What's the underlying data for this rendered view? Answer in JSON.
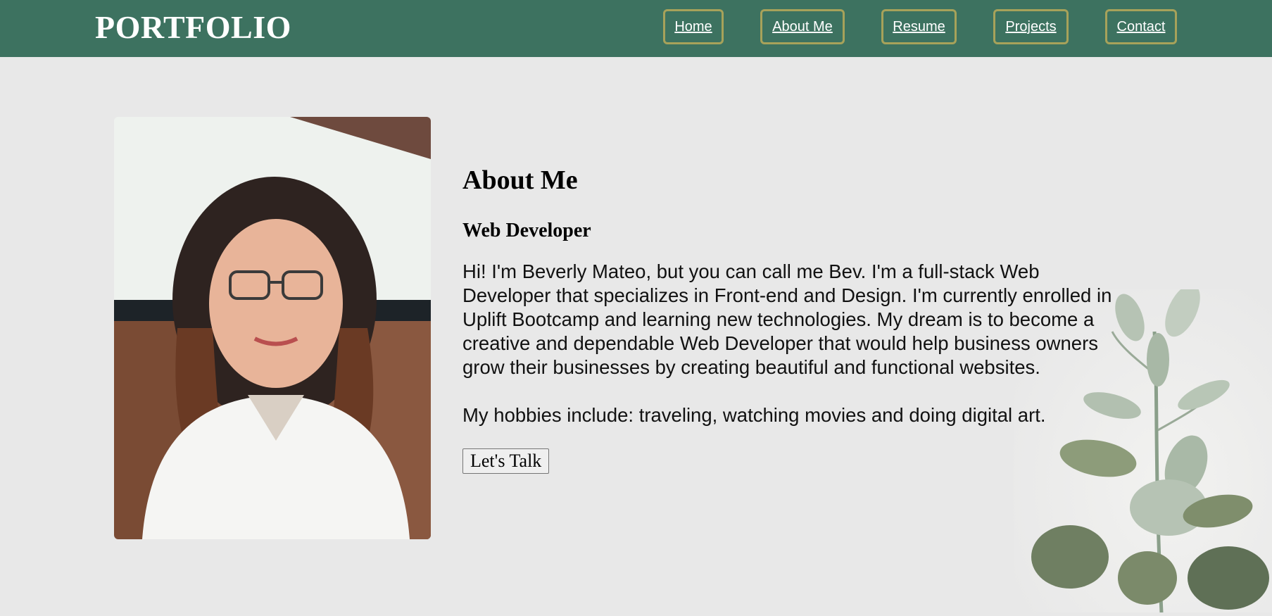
{
  "header": {
    "brand": "PORTFOLIO",
    "nav": [
      {
        "label": "Home"
      },
      {
        "label": "About Me"
      },
      {
        "label": "Resume"
      },
      {
        "label": "Projects"
      },
      {
        "label": "Contact"
      }
    ]
  },
  "about": {
    "title": "About Me",
    "role": "Web Developer",
    "bio": "Hi! I'm Beverly Mateo, but you can call me Bev. I'm a full-stack Web Developer that specializes in Front-end and Design. I'm currently enrolled in Uplift Bootcamp and learning new technologies. My dream is to become a creative and dependable Web Developer that would help business owners grow their businesses by creating beautiful and functional websites.",
    "hobbies": "My hobbies include: traveling, watching movies and doing digital art.",
    "cta_label": "Let's Talk"
  },
  "colors": {
    "navbar_bg": "#3d7260",
    "nav_border": "#a7a25a",
    "page_bg": "#e8e8e8"
  }
}
